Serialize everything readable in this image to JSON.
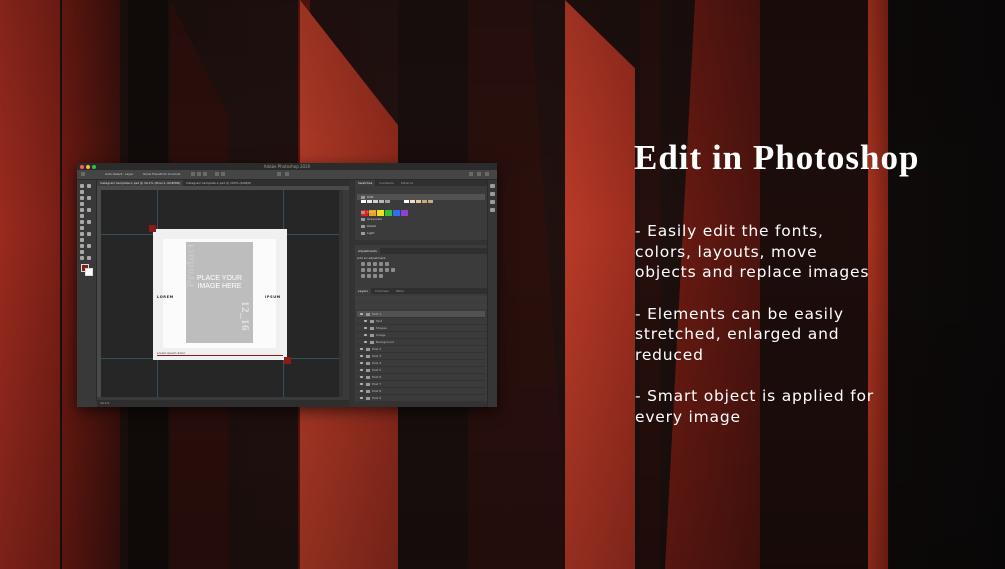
{
  "photoshop": {
    "window_title": "Adobe Photoshop 2020",
    "options_bar": {
      "auto_select": "Auto-Select:",
      "layer": "Layer",
      "show_transform": "Show Transform Controls"
    },
    "doc_tabs": [
      "Instagram template-1.psd @ 16.1% (Pixel 1, RGB/8#)",
      "Instagram template-2.psd @ 100% (RGB/8)"
    ],
    "status_bar": "16.1%",
    "document": {
      "product_word": "Product",
      "placeholder_text": "PLACE YOUR IMAGE HERE",
      "date_word": "12_16",
      "left_word": "LOREM",
      "right_word": "IPSUM",
      "caption": "Lorem ipsum dolor"
    },
    "panels": {
      "swatch_tabs": [
        "Swatches",
        "Gradients",
        "Patterns"
      ],
      "swatch_colors": [
        "#ffffff",
        "#e8e8e8",
        "#d0d0d0",
        "#b8b8b8",
        "#a0a0a0",
        "#ffffff",
        "#f4d9c4",
        "#e9c7a0",
        "#d1a57a",
        "#c7a98c"
      ],
      "swatch_row2": [
        "#e02020",
        "#f0a020",
        "#f0e020",
        "#30c030",
        "#3070f0",
        "#9040d0"
      ],
      "folders": [
        "RGB",
        "CMYK",
        "Grayscale",
        "Pastel",
        "Light"
      ],
      "adjustments_title": "Adjustments",
      "add_adjustment": "Add an adjustment",
      "layers_tabs": [
        "Layers",
        "Channels",
        "Paths"
      ],
      "layers": [
        "Post 1",
        "Text",
        "Shapes",
        "Image",
        "Background",
        "Post 2",
        "Post 3",
        "Post 4",
        "Post 5",
        "Post 6",
        "Post 7",
        "Post 8",
        "Post 9"
      ]
    }
  },
  "headline": "Edit in Photoshop",
  "bullets": [
    "- Easily edit the fonts,\ncolors, layouts, move\nobjects and replace images",
    "- Elements can be easily\nstretched, enlarged and\nreduced",
    "- Smart object is applied for\nevery image"
  ]
}
